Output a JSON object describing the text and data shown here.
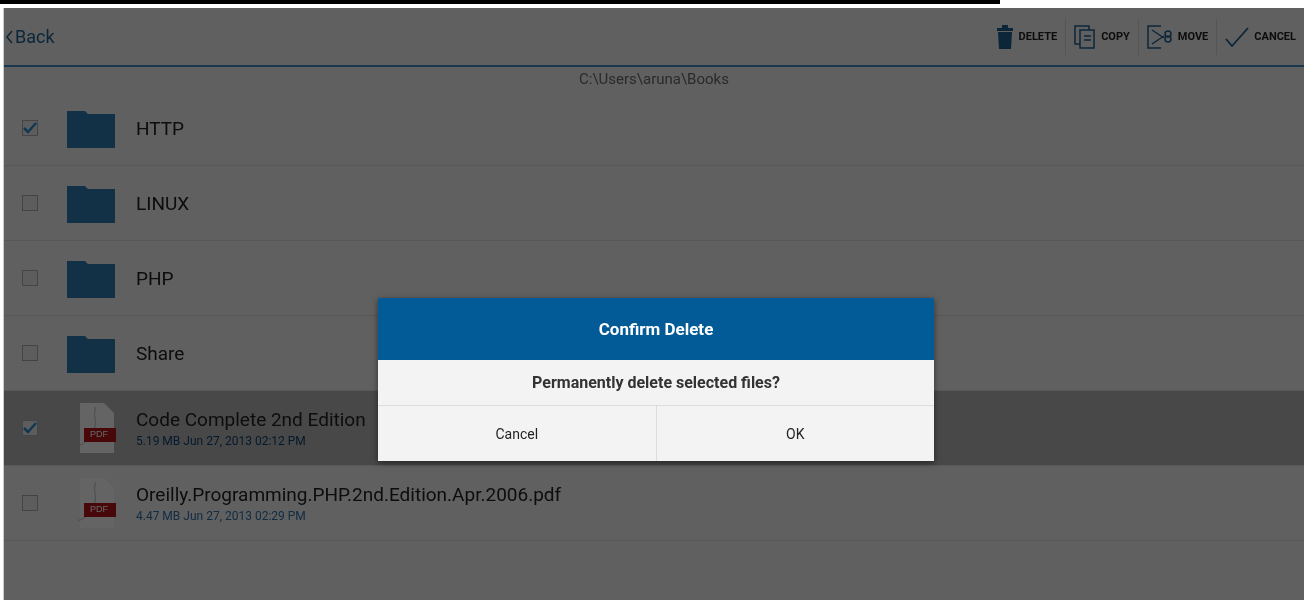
{
  "toolbar": {
    "back": {
      "label": "Back"
    },
    "actions": [
      {
        "label": "DELETE",
        "kind": "delete"
      },
      {
        "label": "COPY",
        "kind": "copy"
      },
      {
        "label": "MOVE",
        "kind": "move"
      },
      {
        "label": "CANCEL",
        "kind": "cancel"
      }
    ]
  },
  "path": "C:\\Users\\aruna\\Books",
  "files": [
    {
      "kind": "folder",
      "name": "HTTP",
      "checked": true,
      "selected": false
    },
    {
      "kind": "folder",
      "name": "LINUX",
      "checked": false,
      "selected": false
    },
    {
      "kind": "folder",
      "name": "PHP",
      "checked": false,
      "selected": false
    },
    {
      "kind": "folder",
      "name": "Share",
      "checked": false,
      "selected": false
    },
    {
      "kind": "pdf",
      "name": "Code Complete 2nd Edition",
      "meta": "5.19 MB  Jun 27, 2013 02:12 PM",
      "badge": "PDF",
      "checked": true,
      "selected": true
    },
    {
      "kind": "pdf",
      "name": "Oreilly.Programming.PHP.2nd.Edition.Apr.2006.pdf",
      "meta": "4.47 MB  Jun 27, 2013 02:29 PM",
      "badge": "PDF",
      "checked": false,
      "selected": false
    }
  ],
  "dialog": {
    "title": "Confirm Delete",
    "message": "Permanently delete selected files?",
    "buttons": [
      "Cancel",
      "OK"
    ]
  }
}
